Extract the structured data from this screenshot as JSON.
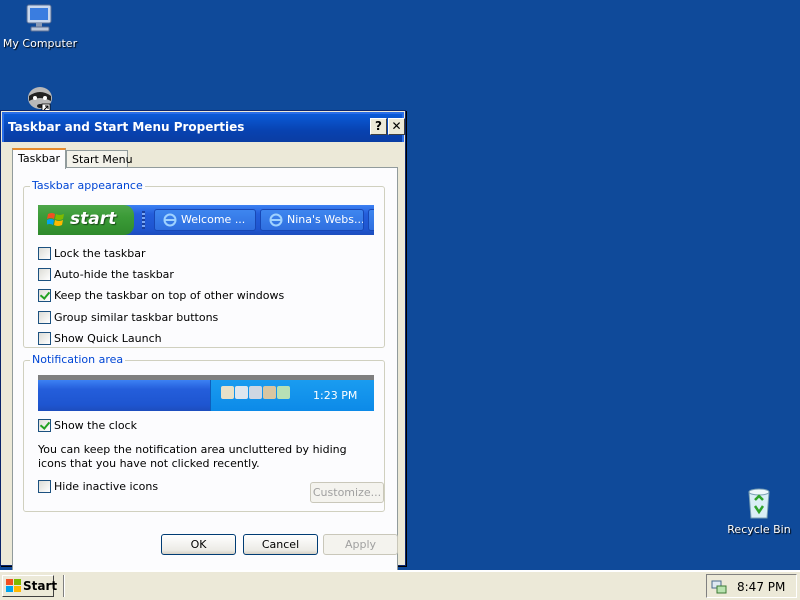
{
  "desktop": {
    "icons": [
      {
        "label": "My Computer"
      },
      {
        "label": ""
      },
      {
        "label": "Recycle Bin"
      }
    ]
  },
  "window": {
    "title": "Taskbar and Start Menu Properties",
    "help_glyph": "?",
    "close_glyph": "✕",
    "tabs": [
      {
        "label": "Taskbar",
        "active": true
      },
      {
        "label": "Start Menu",
        "active": false
      }
    ],
    "appearance": {
      "legend": "Taskbar appearance",
      "preview": {
        "start_label": "start",
        "buttons": [
          "Welcome ...",
          "Nina's Webs...",
          ""
        ]
      },
      "options": [
        {
          "label": "Lock the taskbar",
          "checked": false
        },
        {
          "label": "Auto-hide the taskbar",
          "checked": false
        },
        {
          "label": "Keep the taskbar on top of other windows",
          "checked": true
        },
        {
          "label": "Group similar taskbar buttons",
          "checked": false
        },
        {
          "label": "Show Quick Launch",
          "checked": false
        }
      ]
    },
    "notification": {
      "legend": "Notification area",
      "preview_time": "1:23 PM",
      "show_clock": {
        "label": "Show the clock",
        "checked": true
      },
      "description": "You can keep the notification area uncluttered by hiding icons that you have not clicked recently.",
      "hide_inactive": {
        "label": "Hide inactive icons",
        "checked": false
      },
      "customize_label": "Customize..."
    },
    "buttons": {
      "ok": "OK",
      "cancel": "Cancel",
      "apply": "Apply"
    }
  },
  "taskbar": {
    "start_label": "Start",
    "clock": "8:47 PM"
  },
  "colors": {
    "desktop": "#0f4a9a",
    "titlebar": "#0842b0",
    "legend_text": "#0046d5",
    "start_green": "#3b9b37"
  }
}
